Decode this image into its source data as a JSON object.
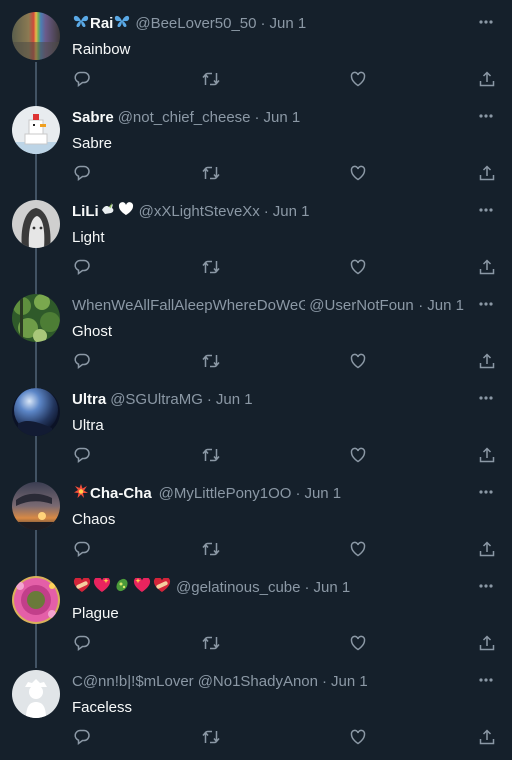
{
  "tweets": [
    {
      "display_name": "Rai",
      "name_style": "bold",
      "handle": "@BeeLover50_50",
      "date": "Jun 1",
      "text": "Rainbow",
      "avatar": "rainbow-avatar"
    },
    {
      "display_name": "Sabre",
      "name_style": "bold",
      "handle": "@not_chief_cheese",
      "date": "Jun 1",
      "text": "Sabre",
      "avatar": "chicken-avatar"
    },
    {
      "display_name": "LiLi",
      "name_style": "bold",
      "handle": "@xXLightSteveXx",
      "date": "Jun 1",
      "text": "Light",
      "avatar": "sketch-avatar"
    },
    {
      "display_name": "WhenWeAllFallAleepWhereDoWeGo",
      "name_style": "plain",
      "handle": "@UserNotFound",
      "date": "Jun 1",
      "text": "Ghost",
      "avatar": "foliage-avatar"
    },
    {
      "display_name": "Ultra",
      "name_style": "bold",
      "handle": "@SGUltraMG",
      "date": "Jun 1",
      "text": "Ultra",
      "avatar": "orb-avatar"
    },
    {
      "display_name": "Cha-Cha",
      "name_style": "bold",
      "handle": "@MyLittlePony1OO",
      "date": "Jun 1",
      "text": "Chaos",
      "avatar": "sunset-avatar"
    },
    {
      "display_name": "",
      "name_style": "bold",
      "handle": "@gelatinous_cube",
      "date": "Jun 1",
      "text": "Plague",
      "avatar": "flower-avatar"
    },
    {
      "display_name": "C@nn!b|!$mLover",
      "name_style": "plain",
      "handle": "@No1ShadyAnon",
      "date": "Jun 1",
      "text": "Faceless",
      "avatar": "default-avatar"
    }
  ],
  "separator": "·",
  "icons": [
    "more-icon",
    "reply-icon",
    "retweet-icon",
    "like-icon",
    "share-icon",
    "butterfly-emoji",
    "dove-emoji",
    "white-heart-emoji",
    "collision-emoji",
    "heart-bandage-emoji",
    "sparkling-heart-emoji",
    "microbe-emoji"
  ],
  "colors": {
    "background": "#15202b",
    "text": "#f7f9f9",
    "muted": "#8b98a5",
    "thread_line": "#425364"
  }
}
